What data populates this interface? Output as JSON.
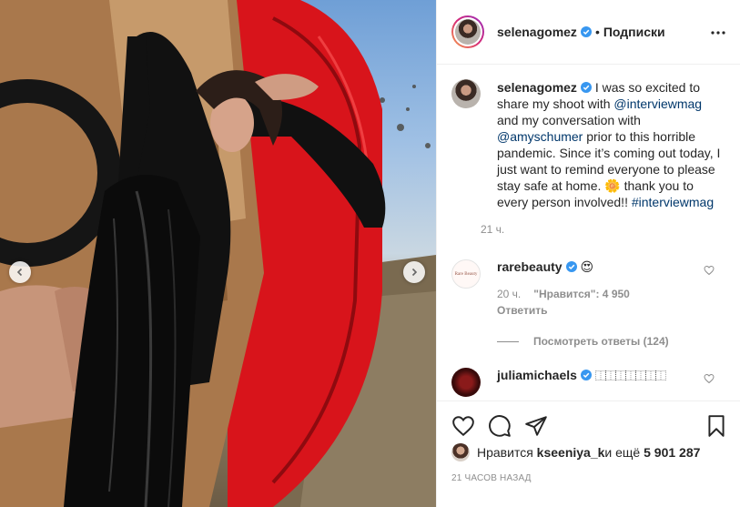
{
  "header": {
    "username": "selenagomez",
    "separator": "•",
    "follow_label": "Подписки"
  },
  "caption": {
    "username": "selenagomez",
    "text_1": " I was so excited to share my shoot with ",
    "mention_1": "@interviewmag",
    "text_2": " and my conversation with ",
    "mention_2": "@amyschumer",
    "text_3": " prior to this horrible pandemic. Since it’s coming out today, I just want to remind everyone to please stay safe at home. 🌼 thank you to every person involved!! ",
    "hashtag": "#interviewmag",
    "time": "21 ч."
  },
  "comments": [
    {
      "username": "rarebeauty",
      "text": "😍",
      "avatar_text": "Rare Beauty",
      "time": "20 ч.",
      "likes": "\"Нравится\": 4 950",
      "reply_label": "Ответить",
      "view_replies": "Посмотреть ответы (124)"
    },
    {
      "username": "juliamichaels",
      "text": "⿰⿰⿰⿰⿰⿰⿰"
    }
  ],
  "likes_bar": {
    "prefix": "Нравится ",
    "user": "kseeniya_k",
    "middle": " и ещё ",
    "count": "5 901 287"
  },
  "time_ago": "21 ЧАСОВ НАЗАД",
  "icons": {
    "verified": "verified-badge-icon",
    "more": "more-options-icon",
    "like": "heart-icon",
    "comment": "comment-icon",
    "share": "paper-plane-icon",
    "save": "bookmark-icon",
    "carousel_prev": "chevron-left-icon",
    "carousel_next": "chevron-right-icon"
  },
  "colors": {
    "verified": "#3897f0",
    "mention": "#00376b",
    "muted": "#8e8e8e",
    "car_red": "#d8141b"
  }
}
